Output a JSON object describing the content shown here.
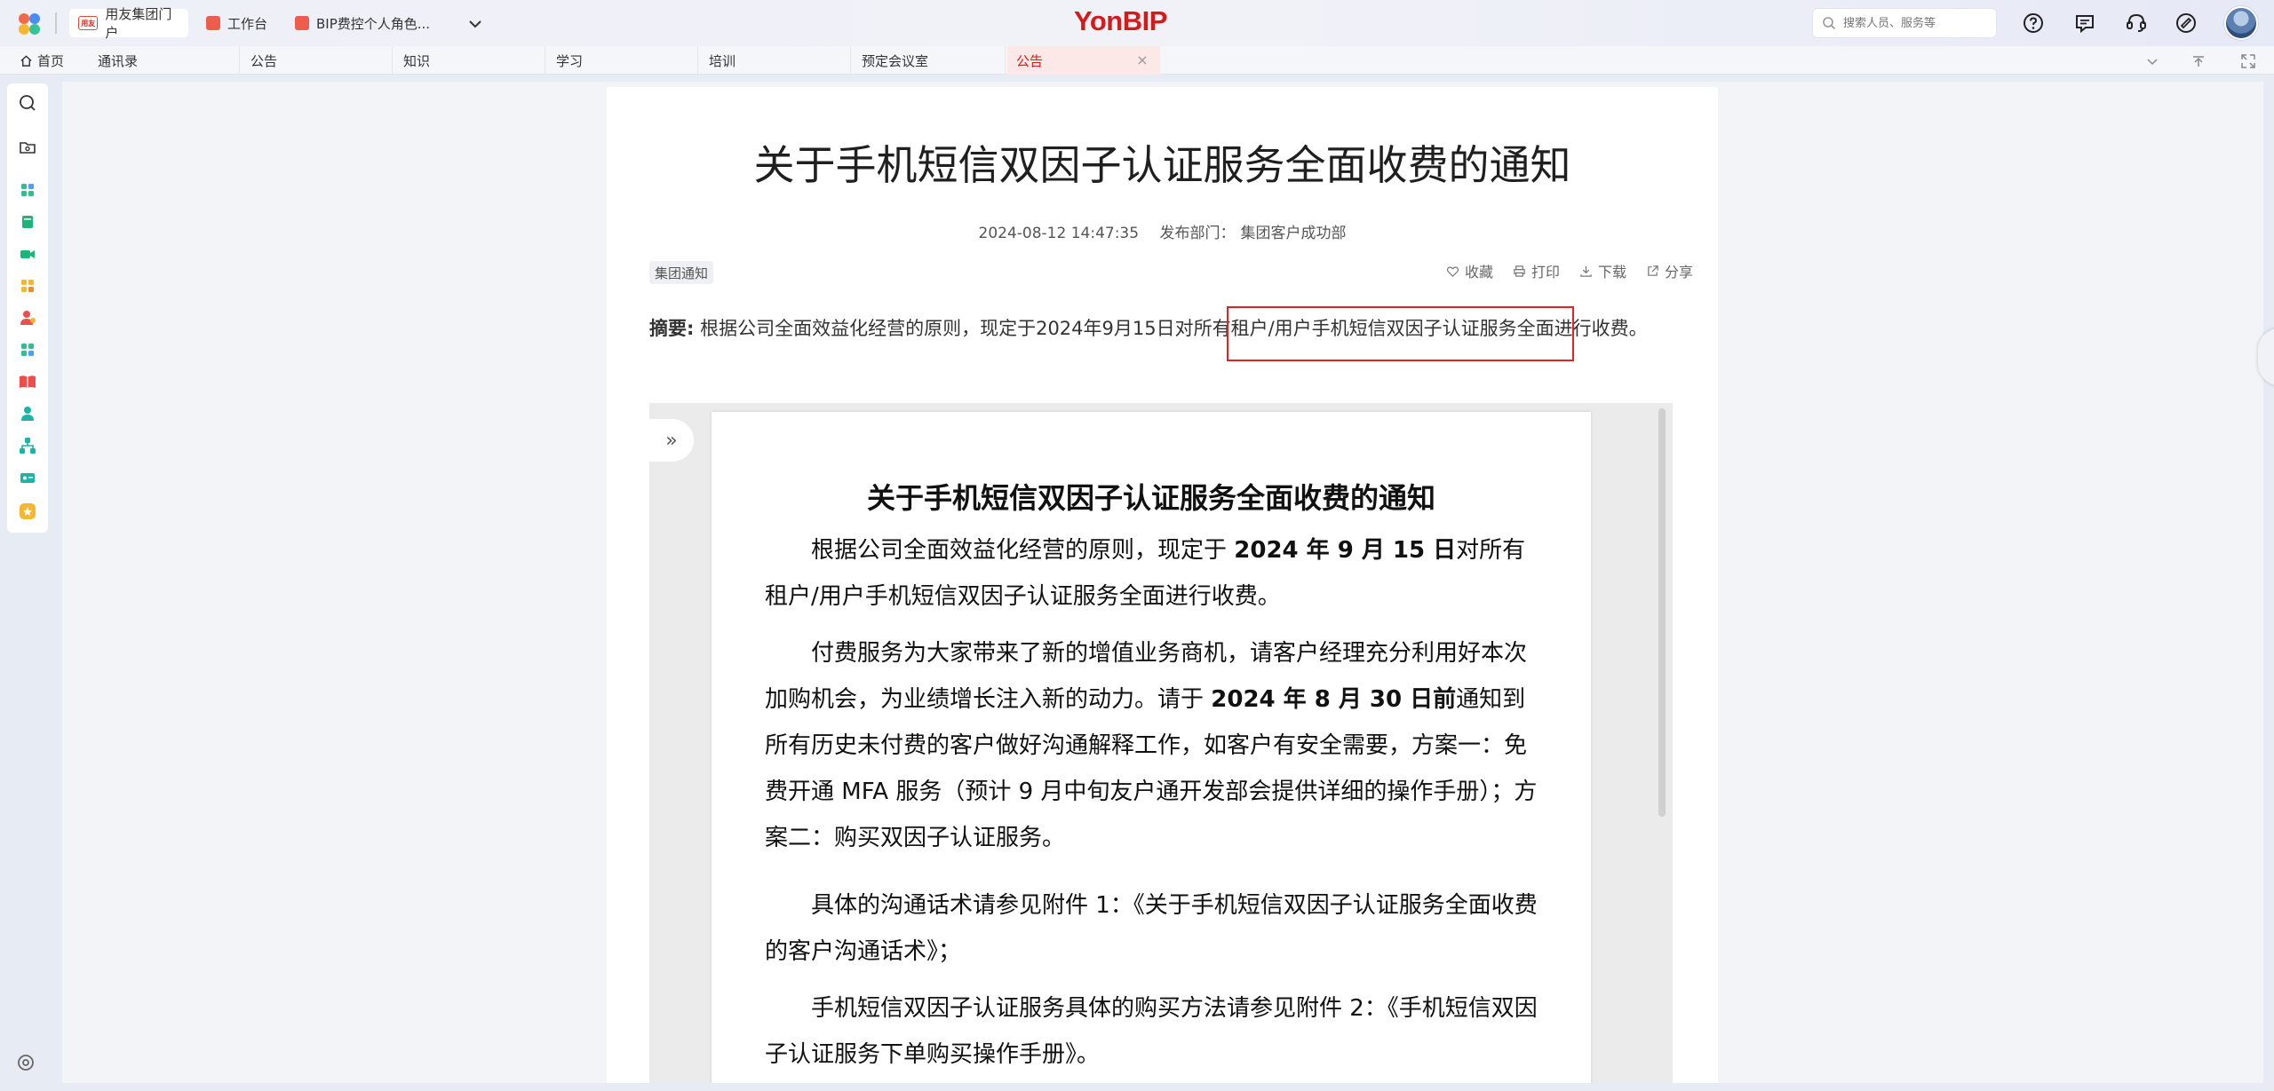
{
  "app": {
    "brand": "YonBIP",
    "tabs": [
      {
        "label": "用友集团门户",
        "icon": "yonyou-logo-icon"
      },
      {
        "label": "工作台",
        "icon": "workbench-icon"
      },
      {
        "label": "BIP费控个人角色...",
        "icon": "expense-app-icon"
      }
    ],
    "search": {
      "placeholder": "搜索人员、服务等"
    },
    "header_icons": [
      "help-icon",
      "message-icon",
      "customer-service-icon",
      "assistant-icon"
    ],
    "colors": {
      "brand": "#d31b1b",
      "highlight_border": "#e02424"
    }
  },
  "navigation": {
    "tabs": [
      {
        "label": "首页",
        "icon": "home-icon"
      },
      {
        "label": "通讯录"
      },
      {
        "label": "公告"
      },
      {
        "label": "知识"
      },
      {
        "label": "学习"
      },
      {
        "label": "培训"
      },
      {
        "label": "预定会议室"
      },
      {
        "label": "公告",
        "active": true
      }
    ]
  },
  "sidebar": {
    "items": [
      "search-icon",
      "folder-icon",
      "app-grid-icon",
      "book-icon",
      "meeting-icon",
      "modules-icon",
      "contacts-icon",
      "apps-icon",
      "learning-icon",
      "person-icon",
      "org-chart-icon",
      "card-icon",
      "star-badge-icon"
    ],
    "bottom": "settings-icon"
  },
  "article": {
    "title": "关于手机短信双因子认证服务全面收费的通知",
    "date": "2024-08-12 14:47:35",
    "department_label": "发布部门：",
    "department": "集团客户成功部",
    "category": "集团通知",
    "actions": [
      {
        "label": "收藏",
        "icon": "heart-icon"
      },
      {
        "label": "打印",
        "icon": "printer-icon"
      },
      {
        "label": "下载",
        "icon": "download-icon"
      },
      {
        "label": "分享",
        "icon": "share-icon"
      }
    ],
    "summary_label": "摘要:",
    "summary_text": " 根据公司全面效益化经营的原则，现定于2024年9月15日对所有租户/用户手机短信双因子认证服务全面进行收费。",
    "highlighted_text": "所有租户/用户手机短信双因子认证服务"
  },
  "document": {
    "title": "关于手机短信双因子认证服务全面收费的通知",
    "p1_a": "根据公司全面效益化经营的原则，现定于 ",
    "p1_bold": "2024 年 9 月 15 日",
    "p1_b": "对所有租户/用户手机短信双因子认证服务全面进行收费。",
    "p2_a": "付费服务为大家带来了新的增值业务商机，请客户经理充分利用好本次加购机会，为业绩增长注入新的动力。请于 ",
    "p2_bold": "2024 年 8 月 30 日前",
    "p2_b": "通知到所有历史未付费的客户做好沟通解释工作，如客户有安全需要，方案一：免费开通 MFA 服务（预计 9 月中旬友户通开发部会提供详细的操作手册）；方案二：购买双因子认证服务。",
    "p3": "具体的沟通话术请参见附件 1：《关于手机短信双因子认证服务全面收费的客户沟通话术》；",
    "p4": "手机短信双因子认证服务具体的购买方法请参见附件 2：《手机短信双因子认证服务下单购买操作手册》。"
  }
}
